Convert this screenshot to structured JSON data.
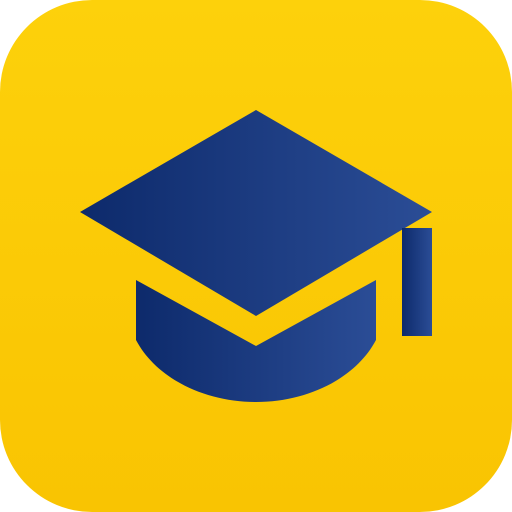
{
  "app_icon": {
    "icon_name": "graduation-cap-icon",
    "colors": {
      "background_top": "#FDD10B",
      "background_bottom": "#F9C402",
      "cap_left": "#0D2A6B",
      "cap_right": "#2B4D96"
    }
  }
}
